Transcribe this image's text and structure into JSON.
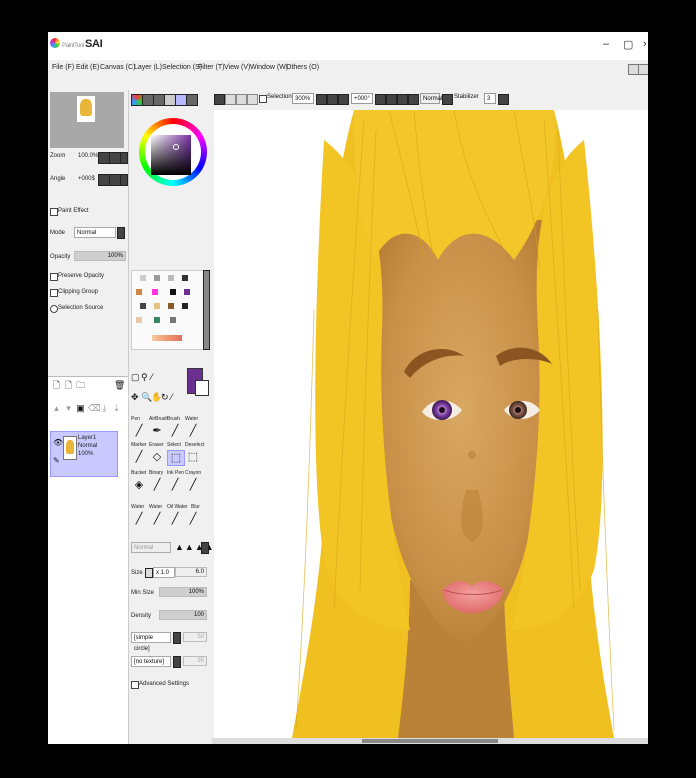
{
  "app": {
    "title": "SAI",
    "title_prefix": "PaintTool",
    "window_controls": {
      "minimize": "–",
      "maximize": "▢",
      "close": "›"
    }
  },
  "menu": {
    "items": [
      "File (F)",
      "Edit (E)",
      "Canvas (C)",
      "Layer (L)",
      "Selection (S)",
      "Filter (T)",
      "View (V)",
      "Window (W)",
      "Others (O)"
    ]
  },
  "navigator": {
    "zoom_label": "Zoom",
    "zoom_value": "100.0%",
    "angle_label": "Angle",
    "angle_value": "+000$"
  },
  "layer_props": {
    "paint_effect_label": "Paint Effect",
    "mode_label": "Mode",
    "mode_value": "Normal",
    "opacity_label": "Opacity",
    "opacity_value": "100%",
    "preserve_opacity_label": "Preserve Opacity",
    "clipping_group_label": "Clipping Group",
    "selection_source_label": "Selection Source"
  },
  "layers": [
    {
      "name": "Layer1",
      "mode": "Normal",
      "opacity": "100%"
    }
  ],
  "toolbar": {
    "selection_label": "Selection",
    "zoom_value": "300%",
    "angle_value": "+000°",
    "blend_value": "Normal",
    "stabilizer_label": "Stabilizer",
    "stabilizer_value": "3"
  },
  "tools": {
    "brush_labels": [
      "Pen",
      "AirBrush",
      "Brush",
      "Water",
      "Marker",
      "Eraser",
      "Select",
      "Deselect",
      "Bucket",
      "Binary",
      "Ink Pen",
      "Crayon",
      "Water",
      "Water",
      "Oil Water",
      "Blur"
    ]
  },
  "brush_settings": {
    "blend_value": "Normal",
    "size_label": "Size",
    "size_multiplier": "x 1.0",
    "size_value": "6.0",
    "min_size_label": "Min Size",
    "min_size_value": "100%",
    "density_label": "Density",
    "density_value": "100",
    "shape_value": "[simple circle]",
    "shape_strength": "50",
    "texture_value": "[no texture]",
    "texture_strength": "95",
    "advanced_label": "Advanced Settings"
  },
  "colors": {
    "hair": "#f0c020",
    "skin": "#cf9a52",
    "lips": "#ea7a7a",
    "selected_layer": "#c9c9ff",
    "current_color": "#6a2f8f"
  },
  "icons": [
    "minimize-icon",
    "maximize-icon",
    "close-icon",
    "new-layer-icon",
    "folder-icon",
    "trash-icon",
    "eye-icon",
    "pen-icon",
    "brush-icon",
    "eraser-icon",
    "bucket-icon",
    "zoom-icon",
    "hand-icon",
    "rotate-icon"
  ]
}
